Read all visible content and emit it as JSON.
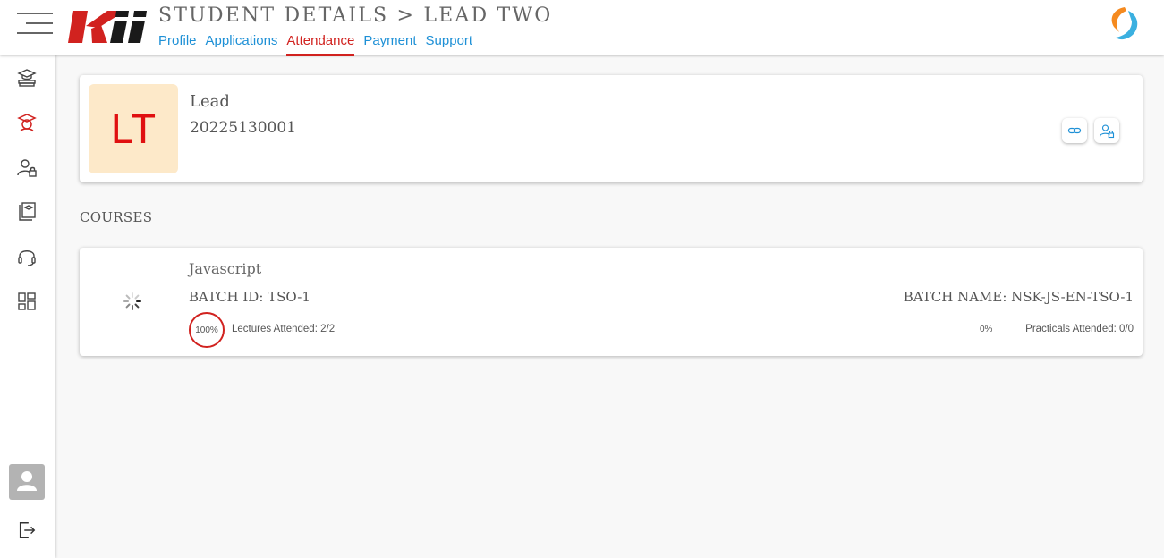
{
  "header": {
    "title": "STUDENT DETAILS > LEAD TWO",
    "tabs": [
      {
        "label": "Profile",
        "active": false
      },
      {
        "label": "Applications",
        "active": false
      },
      {
        "label": "Attendance",
        "active": true
      },
      {
        "label": "Payment",
        "active": false
      },
      {
        "label": "Support",
        "active": false
      }
    ],
    "accent_color": "#d1221f",
    "link_color": "#1e90d6"
  },
  "sidebar": {
    "items": [
      {
        "icon": "graduation-books-icon",
        "active": false
      },
      {
        "icon": "student-cap-icon",
        "active": true
      },
      {
        "icon": "user-lock-icon",
        "active": false
      },
      {
        "icon": "course-book-icon",
        "active": false
      },
      {
        "icon": "headset-icon",
        "active": false
      },
      {
        "icon": "grid-icon",
        "active": false
      }
    ],
    "avatar_icon": "user-avatar-icon",
    "logout_icon": "logout-icon"
  },
  "student": {
    "initials": "LT",
    "name": "Lead",
    "id": "20225130001",
    "actions": [
      {
        "icon": "link-icon"
      },
      {
        "icon": "user-lock-icon"
      }
    ]
  },
  "courses_section": {
    "title": "COURSES",
    "courses": [
      {
        "name": "Javascript",
        "batch_id": "BATCH ID: TSO-1",
        "batch_name": "BATCH NAME: NSK-JS-EN-TSO-1",
        "lecture_percent": "100%",
        "lectures": "Lectures Attended: 2/2",
        "practical_percent": "0%",
        "practicals": "Practicals Attended: 0/0"
      }
    ]
  }
}
